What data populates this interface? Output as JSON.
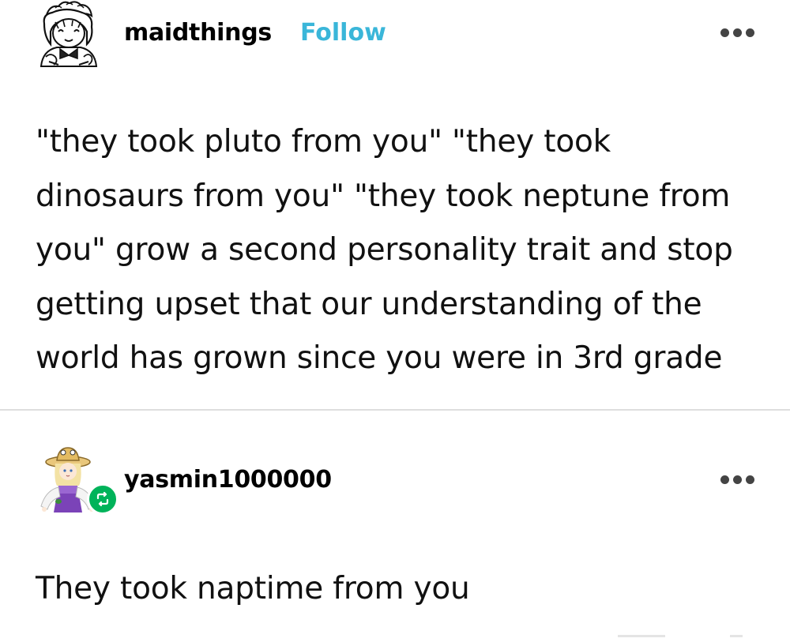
{
  "original_post": {
    "username": "maidthings",
    "follow_label": "Follow",
    "avatar_icon": "maid-avatar-icon",
    "more_icon": "more-options-icon",
    "body_lines": [
      "\"they took pluto from you\" \"they took",
      "dinosaurs from you\" \"they took neptune from",
      "you\" grow a second personality trait and stop",
      "getting upset that our understanding of the",
      "world has grown since you were in 3rd grade"
    ]
  },
  "reblog": {
    "username": "yasmin1000000",
    "avatar_icon": "straw-hat-girl-avatar-icon",
    "badge_icon": "reblog-icon",
    "badge_color": "#00b35a",
    "more_icon": "more-options-icon",
    "body": "They took naptime from you"
  },
  "colors": {
    "follow": "#3ab6d9",
    "text": "#111111",
    "divider": "#dedede"
  }
}
